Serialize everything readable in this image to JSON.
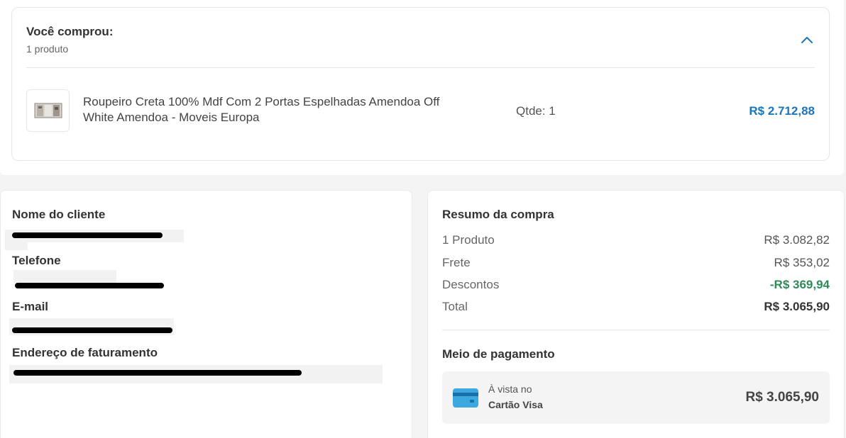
{
  "order": {
    "title": "Você comprou:",
    "subtitle": "1 produto",
    "product": {
      "name": "Roupeiro Creta 100% Mdf Com 2 Portas Espelhadas Amendoa Off White Amendoa - Moveis Europa",
      "qty": "Qtde: 1",
      "price": "R$ 2.712,88"
    },
    "collapse_icon": "chevron-up-icon"
  },
  "customer": {
    "name_label": "Nome do cliente",
    "phone_label": "Telefone",
    "email_label": "E-mail",
    "address_label": "Endereço de faturamento"
  },
  "summary": {
    "title": "Resumo da compra",
    "rows": [
      {
        "label": "1 Produto",
        "value": "R$ 3.082,82"
      },
      {
        "label": "Frete",
        "value": "R$ 353,02"
      },
      {
        "label": "Descontos",
        "value": "-R$ 369,94"
      },
      {
        "label": "Total",
        "value": "R$ 3.065,90"
      }
    ],
    "payment_title": "Meio de pagamento",
    "payment": {
      "line1": "À vista no",
      "line2": "Cartão Visa",
      "amount": "R$ 3.065,90",
      "icon": "credit-card-icon"
    }
  },
  "colors": {
    "price_blue": "#1a75bb",
    "discount_green": "#2e8b57",
    "card_icon_blue": "#3ba8e0"
  }
}
